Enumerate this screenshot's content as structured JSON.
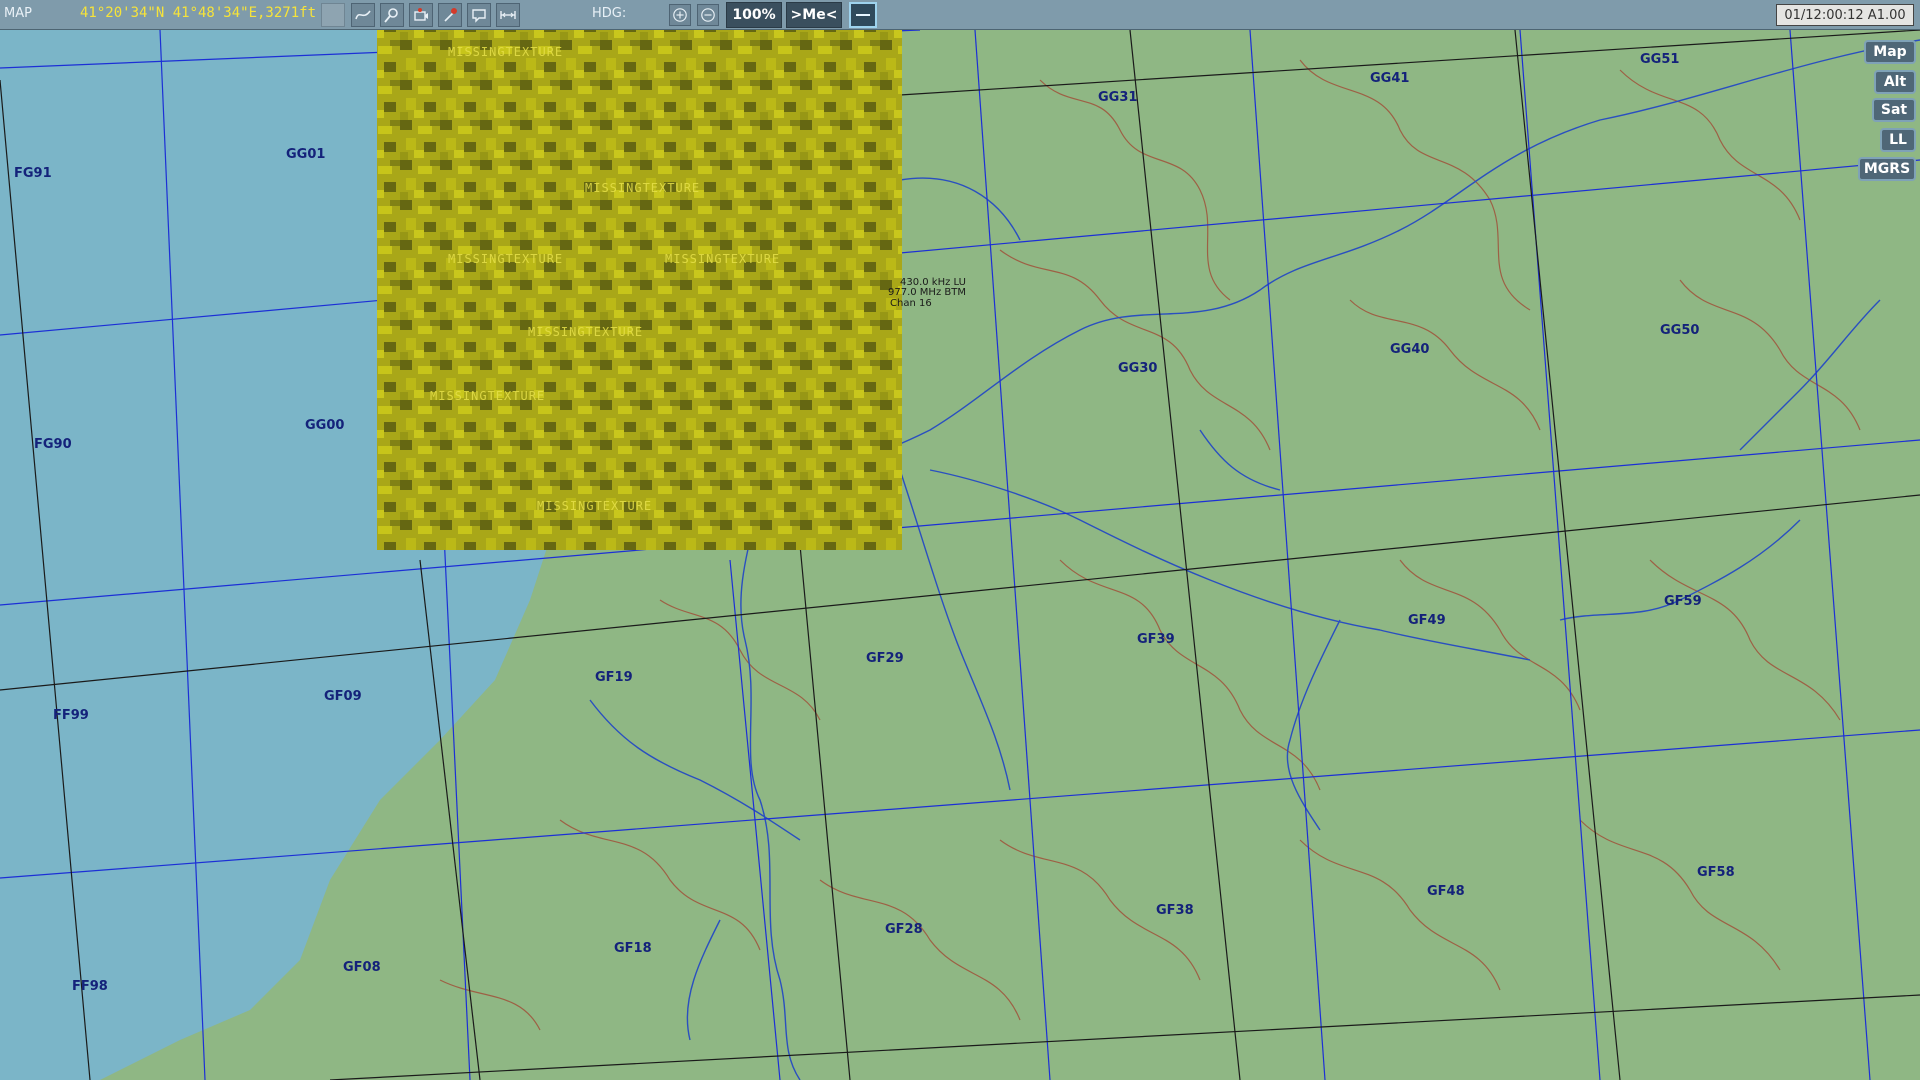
{
  "toolbar": {
    "mode_label": "MAP",
    "coordinates": "41°20'34\"N 41°48'34\"E,3271ft",
    "hdg_label": "HDG:",
    "zoom_level": "100%",
    "me_label": ">Me<",
    "clock": "01/12:00:12 A1.00"
  },
  "side_buttons": {
    "map": "Map",
    "alt": "Alt",
    "sat": "Sat",
    "ll": "LL",
    "mgrs": "MGRS"
  },
  "grid_labels": [
    "GG51",
    "GG41",
    "GG31",
    "GG01",
    "FG91",
    "GG40",
    "GG50",
    "GG30",
    "GG00",
    "FG90",
    "GF59",
    "GF49",
    "GF39",
    "GF29",
    "GF19",
    "GF09",
    "FF99",
    "GF58",
    "GF48",
    "GF38",
    "GF28",
    "GF18",
    "GF08",
    "FF98"
  ],
  "texture_label": "MISSINGTEXTURE",
  "nav_aid": {
    "line1": "430.0 kHz LU",
    "line2": "977.0 MHz BTM",
    "line3": "Chan 16"
  },
  "colors": {
    "water": "#7bb5c8",
    "land": "#8fb784",
    "contour": "#a0513a",
    "river": "#2a4fc0",
    "grid_blue": "#1c2fd6",
    "grid_black": "#1a1a1a",
    "toolbar": "#7f9bab",
    "coords_text": "#f6e33a"
  }
}
